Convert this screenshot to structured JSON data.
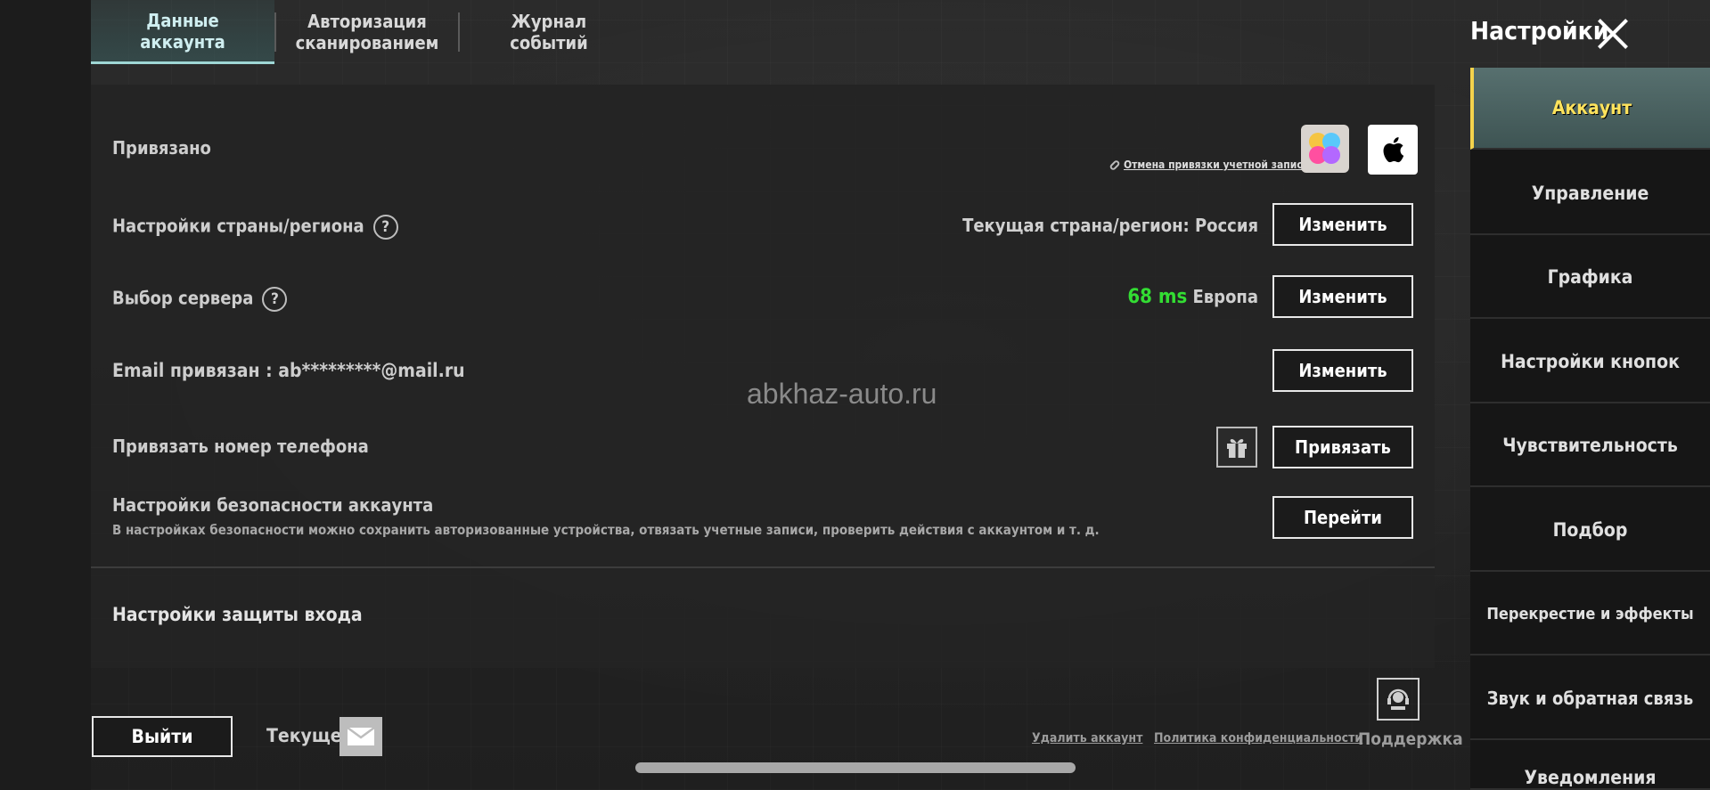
{
  "header": {
    "tabs": [
      {
        "label": "Данные аккаунта",
        "active": true
      },
      {
        "label": "Авторизация сканированием",
        "active": false
      },
      {
        "label": "Журнал событий",
        "active": false
      }
    ],
    "settings_title": "Настройки"
  },
  "rows": {
    "linked": {
      "label": "Привязано",
      "unlink_text": "Отмена привязки учетной записи"
    },
    "region": {
      "label": "Настройки страны/региона",
      "value": "Текущая страна/регион: Россия",
      "button": "Изменить"
    },
    "server": {
      "label": "Выбор сервера",
      "ping": "68 ms",
      "server_name": "Европа",
      "button": "Изменить"
    },
    "email": {
      "label": "Email привязан : ab*********@mail.ru",
      "button": "Изменить"
    },
    "phone": {
      "label": "Привязать номер телефона",
      "button": "Привязать"
    },
    "security": {
      "label": "Настройки безопасности аккаунта",
      "description": "В настройках безопасности можно сохранить авторизованные устройства, отвязать учетные записи, проверить действия с аккаунтом и т. д.",
      "button": "Перейти"
    },
    "login_protection": {
      "label": "Настройки защиты входа"
    }
  },
  "watermark": "abkhaz-auto.ru",
  "sidebar": {
    "items": [
      {
        "label": "Аккаунт",
        "active": true
      },
      {
        "label": "Управление",
        "active": false
      },
      {
        "label": "Графика",
        "active": false
      },
      {
        "label": "Настройки кнопок",
        "active": false
      },
      {
        "label": "Чувствительность",
        "active": false
      },
      {
        "label": "Подбор",
        "active": false
      },
      {
        "label": "Перекрестие и эффекты",
        "active": false
      },
      {
        "label": "Звук и обратная связь",
        "active": false
      },
      {
        "label": "Уведомления",
        "active": false
      }
    ]
  },
  "footer": {
    "exit_label": "Выйти",
    "current_label": "Текущее",
    "delete_account": "Удалить аккаунт",
    "privacy_policy": "Политика конфиденциальности",
    "support_label": "Поддержка"
  },
  "colors": {
    "ping_green": "#33dd33",
    "active_sidebar_text": "#ffe35c",
    "active_tab_underline": "#9fd7d5"
  },
  "icons": [
    "close-icon",
    "help-icon",
    "link-icon",
    "game-center-icon",
    "apple-icon",
    "gift-icon",
    "mail-icon",
    "support-icon"
  ]
}
